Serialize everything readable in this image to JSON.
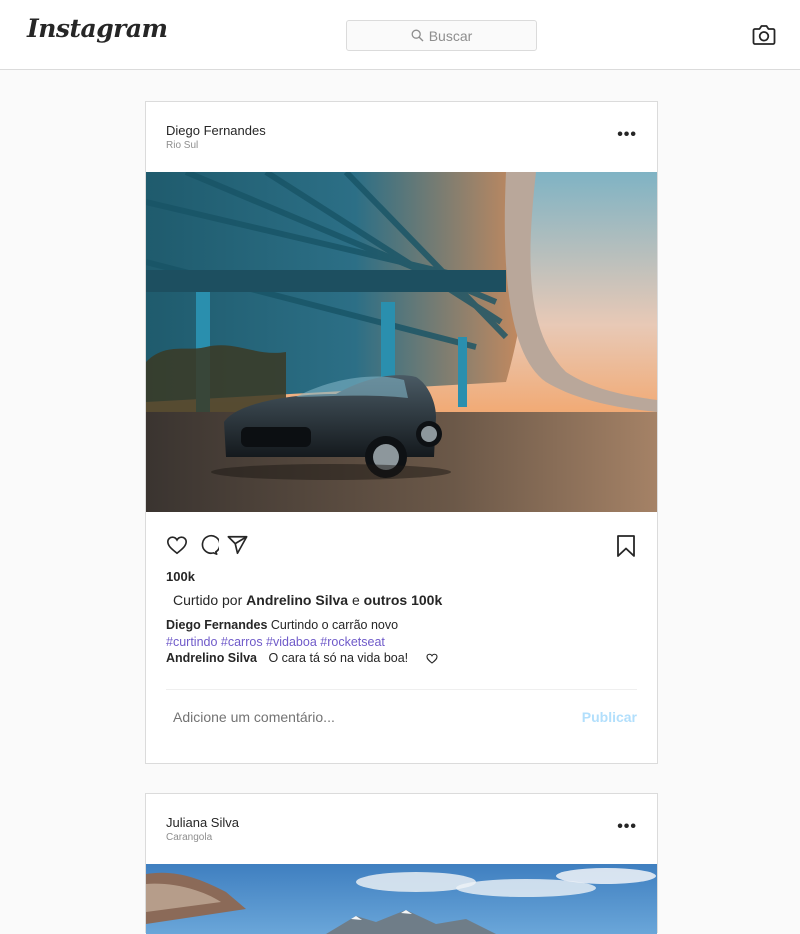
{
  "header": {
    "logo": "Instagram",
    "search_placeholder": "Buscar"
  },
  "posts": [
    {
      "author": "Diego Fernandes",
      "location": "Rio Sul",
      "more": "•••",
      "likes": "100k",
      "liked_by_prefix": "Curtido por",
      "liked_by_user": "Andrelino Silva",
      "liked_by_middle": "e",
      "liked_by_others": "outros 100k",
      "caption_author": "Diego Fernandes",
      "caption_text": "Curtindo o carrão novo",
      "hashtags": "#curtindo #carros #vidaboa #rocketseat",
      "comment_author": "Andrelino Silva",
      "comment_text": "O cara tá só na vida boa!",
      "add_comment_placeholder": "Adicione um comentário...",
      "publish_label": "Publicar"
    },
    {
      "author": "Juliana Silva",
      "location": "Carangola",
      "more": "•••"
    }
  ],
  "colors": {
    "hashtag": "#6f5ac9",
    "publish_disabled": "#b2dffc",
    "border": "#dbdbdb"
  }
}
